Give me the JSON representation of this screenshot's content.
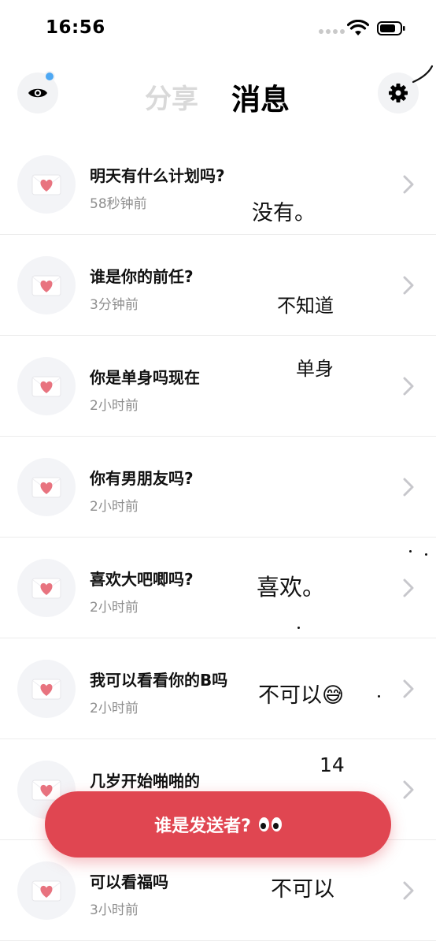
{
  "status_bar": {
    "time": "16:56"
  },
  "header": {
    "tab_share": "分享",
    "tab_messages": "消息"
  },
  "messages": [
    {
      "question": "明天有什么计划吗?",
      "time": "58秒钟前",
      "answer": "没有。"
    },
    {
      "question": "谁是你的前任?",
      "time": "3分钟前",
      "answer": "不知道"
    },
    {
      "question": "你是单身吗现在",
      "time": "2小时前",
      "answer": "单身"
    },
    {
      "question": "你有男朋友吗?",
      "time": "2小时前",
      "answer": ""
    },
    {
      "question": "喜欢大吧唧吗?",
      "time": "2小时前",
      "answer": "喜欢。"
    },
    {
      "question": "我可以看看你的B吗",
      "time": "2小时前",
      "answer": "不可以😅"
    },
    {
      "question": "几岁开始啪啪的",
      "time": "",
      "answer": "14"
    },
    {
      "question": "可以看福吗",
      "time": "3小时前",
      "answer": "不可以"
    }
  ],
  "cta": {
    "label": "谁是发送者?"
  },
  "colors": {
    "accent": "#e04651",
    "badge": "#4ea8f3",
    "icon_bg": "#f3f4f7",
    "heart": "#e8737f"
  }
}
